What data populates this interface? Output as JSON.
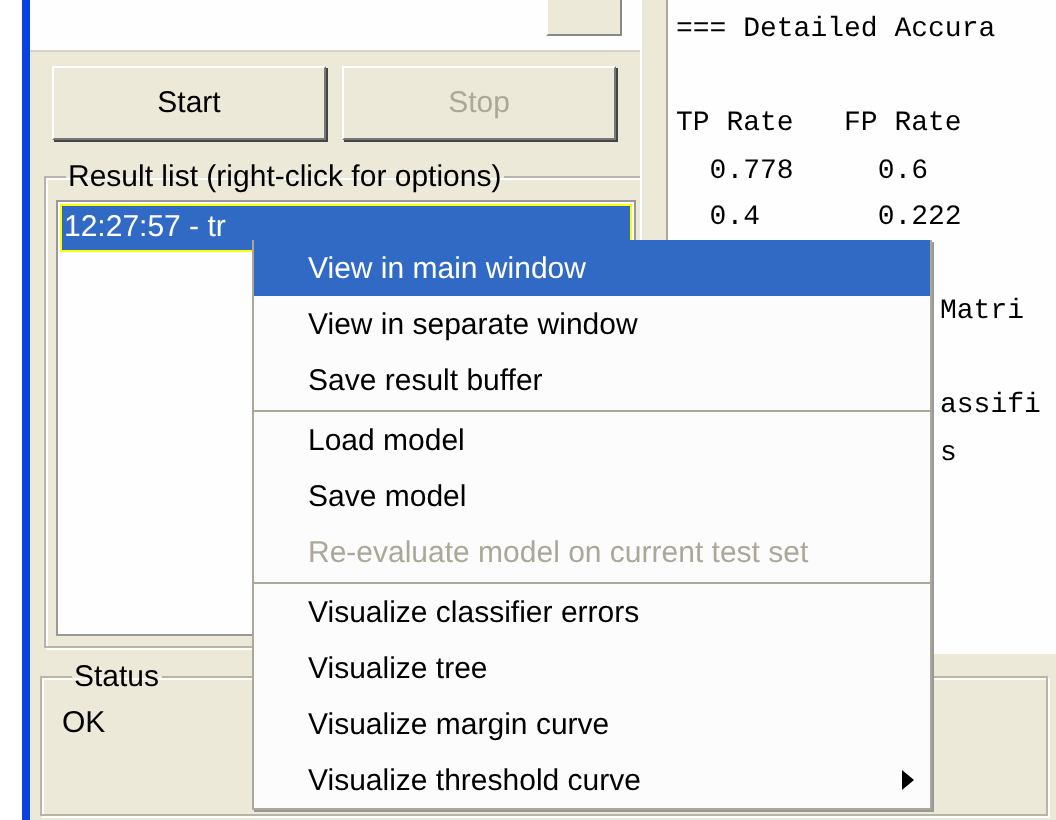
{
  "buttons": [
    {
      "label": "Start",
      "disabled": false
    },
    {
      "label": "Stop",
      "disabled": true
    }
  ],
  "result_list": {
    "title": "Result list (right-click for options)",
    "items": [
      {
        "label": "12:27:57 - tr",
        "selected": true
      }
    ]
  },
  "output": {
    "lines": [
      {
        "text": "=== Detailed Accura",
        "covered": false
      },
      {
        "text": "TP Rate   FP Rate",
        "covered": false
      },
      {
        "text": "  0.778     0.6",
        "covered": false
      },
      {
        "text": "  0.4       0.222",
        "covered": false
      },
      {
        "text": "Matri",
        "covered": true
      },
      {
        "text": "assifi",
        "covered": true
      },
      {
        "text": "s",
        "covered": true
      }
    ]
  },
  "status": {
    "title": "Status",
    "text": "OK"
  },
  "context_menu": {
    "items": [
      {
        "label": "View in main window",
        "selected": true,
        "disabled": false,
        "separator_before": false,
        "submenu": false
      },
      {
        "label": "View in separate window",
        "selected": false,
        "disabled": false,
        "separator_before": false,
        "submenu": false
      },
      {
        "label": "Save result buffer",
        "selected": false,
        "disabled": false,
        "separator_before": false,
        "submenu": false
      },
      {
        "label": "Load model",
        "selected": false,
        "disabled": false,
        "separator_before": true,
        "submenu": false
      },
      {
        "label": "Save model",
        "selected": false,
        "disabled": false,
        "separator_before": false,
        "submenu": false
      },
      {
        "label": "Re-evaluate model on current test set",
        "selected": false,
        "disabled": true,
        "separator_before": false,
        "submenu": false
      },
      {
        "label": "Visualize classifier errors",
        "selected": false,
        "disabled": false,
        "separator_before": true,
        "submenu": false
      },
      {
        "label": "Visualize tree",
        "selected": false,
        "disabled": false,
        "separator_before": false,
        "submenu": false
      },
      {
        "label": "Visualize margin curve",
        "selected": false,
        "disabled": false,
        "separator_before": false,
        "submenu": false
      },
      {
        "label": "Visualize threshold curve",
        "selected": false,
        "disabled": false,
        "separator_before": false,
        "submenu": true
      }
    ]
  }
}
